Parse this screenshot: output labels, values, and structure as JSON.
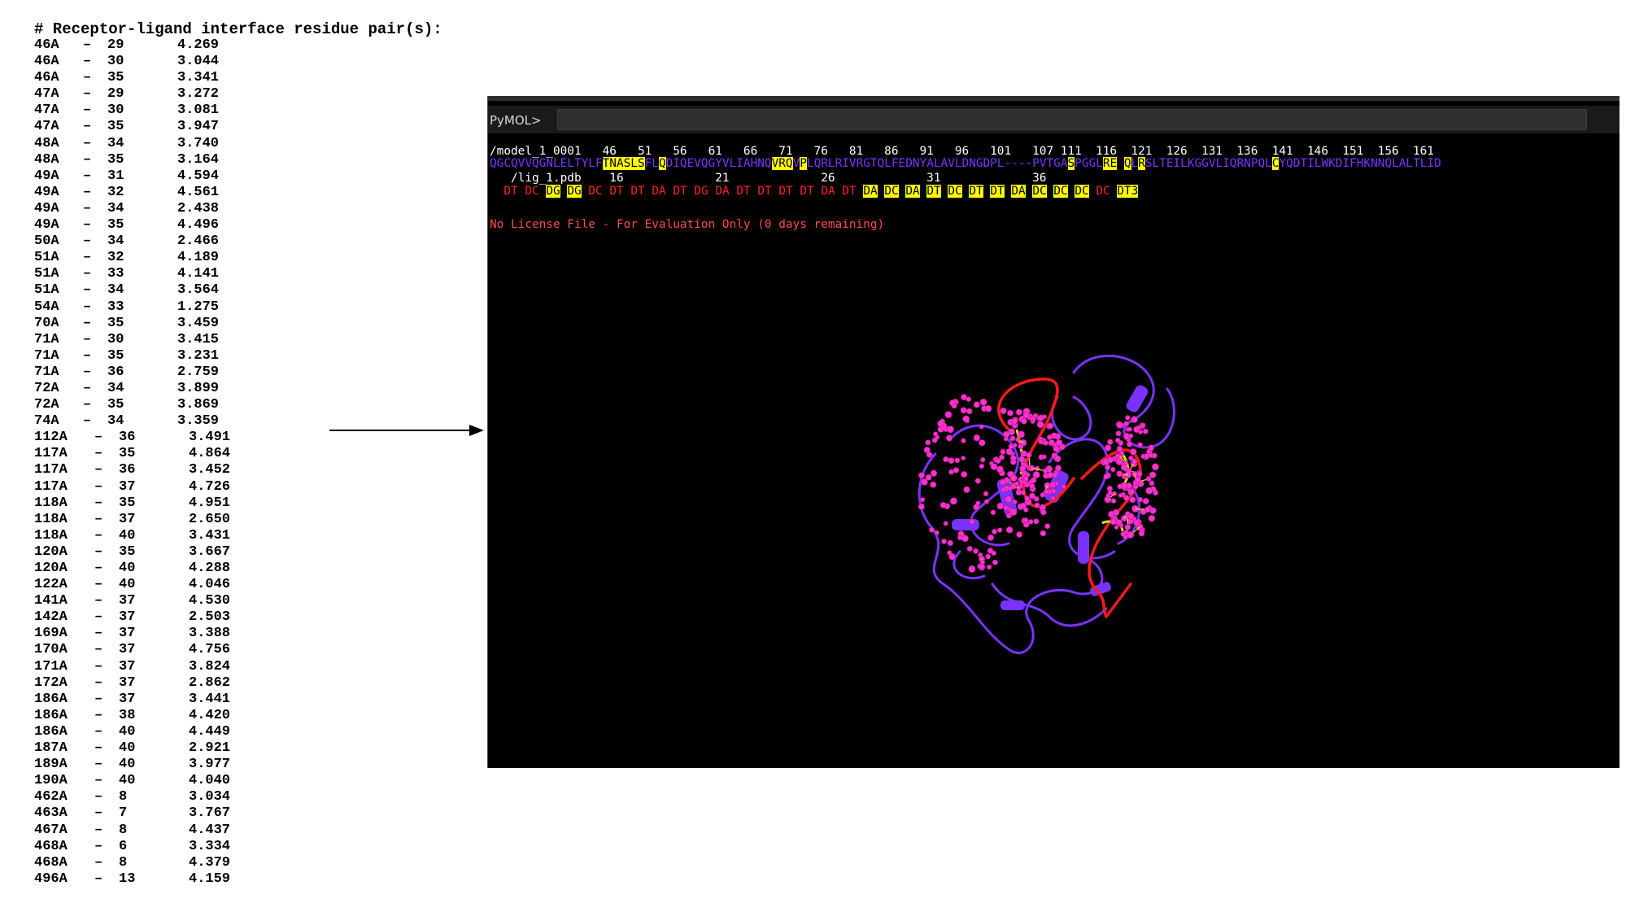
{
  "residue_list": {
    "header": "# Receptor-ligand interface residue pair(s):",
    "rows": [
      {
        "a": "46A",
        "b": "29",
        "d": "4.269"
      },
      {
        "a": "46A",
        "b": "30",
        "d": "3.044"
      },
      {
        "a": "46A",
        "b": "35",
        "d": "3.341"
      },
      {
        "a": "47A",
        "b": "29",
        "d": "3.272"
      },
      {
        "a": "47A",
        "b": "30",
        "d": "3.081"
      },
      {
        "a": "47A",
        "b": "35",
        "d": "3.947"
      },
      {
        "a": "48A",
        "b": "34",
        "d": "3.740"
      },
      {
        "a": "48A",
        "b": "35",
        "d": "3.164"
      },
      {
        "a": "49A",
        "b": "31",
        "d": "4.594"
      },
      {
        "a": "49A",
        "b": "32",
        "d": "4.561"
      },
      {
        "a": "49A",
        "b": "34",
        "d": "2.438"
      },
      {
        "a": "49A",
        "b": "35",
        "d": "4.496"
      },
      {
        "a": "50A",
        "b": "34",
        "d": "2.466"
      },
      {
        "a": "51A",
        "b": "32",
        "d": "4.189"
      },
      {
        "a": "51A",
        "b": "33",
        "d": "4.141"
      },
      {
        "a": "51A",
        "b": "34",
        "d": "3.564"
      },
      {
        "a": "54A",
        "b": "33",
        "d": "1.275"
      },
      {
        "a": "70A",
        "b": "35",
        "d": "3.459"
      },
      {
        "a": "71A",
        "b": "30",
        "d": "3.415"
      },
      {
        "a": "71A",
        "b": "35",
        "d": "3.231"
      },
      {
        "a": "71A",
        "b": "36",
        "d": "2.759"
      },
      {
        "a": "72A",
        "b": "34",
        "d": "3.899"
      },
      {
        "a": "72A",
        "b": "35",
        "d": "3.869"
      },
      {
        "a": "74A",
        "b": "34",
        "d": "3.359"
      },
      {
        "a": "112A",
        "b": "36",
        "d": "3.491"
      },
      {
        "a": "117A",
        "b": "35",
        "d": "4.864"
      },
      {
        "a": "117A",
        "b": "36",
        "d": "3.452"
      },
      {
        "a": "117A",
        "b": "37",
        "d": "4.726"
      },
      {
        "a": "118A",
        "b": "35",
        "d": "4.951"
      },
      {
        "a": "118A",
        "b": "37",
        "d": "2.650"
      },
      {
        "a": "118A",
        "b": "40",
        "d": "3.431"
      },
      {
        "a": "120A",
        "b": "35",
        "d": "3.667"
      },
      {
        "a": "120A",
        "b": "40",
        "d": "4.288"
      },
      {
        "a": "122A",
        "b": "40",
        "d": "4.046"
      },
      {
        "a": "141A",
        "b": "37",
        "d": "4.530"
      },
      {
        "a": "142A",
        "b": "37",
        "d": "2.503"
      },
      {
        "a": "169A",
        "b": "37",
        "d": "3.388"
      },
      {
        "a": "170A",
        "b": "37",
        "d": "4.756"
      },
      {
        "a": "171A",
        "b": "37",
        "d": "3.824"
      },
      {
        "a": "172A",
        "b": "37",
        "d": "2.862"
      },
      {
        "a": "186A",
        "b": "37",
        "d": "3.441"
      },
      {
        "a": "186A",
        "b": "38",
        "d": "4.420"
      },
      {
        "a": "186A",
        "b": "40",
        "d": "4.449"
      },
      {
        "a": "187A",
        "b": "40",
        "d": "2.921"
      },
      {
        "a": "189A",
        "b": "40",
        "d": "3.977"
      },
      {
        "a": "190A",
        "b": "40",
        "d": "4.040"
      },
      {
        "a": "462A",
        "b": "8",
        "d": "3.034"
      },
      {
        "a": "463A",
        "b": "7",
        "d": "3.767"
      },
      {
        "a": "467A",
        "b": "8",
        "d": "4.437"
      },
      {
        "a": "468A",
        "b": "6",
        "d": "3.334"
      },
      {
        "a": "468A",
        "b": "8",
        "d": "4.379"
      },
      {
        "a": "496A",
        "b": "13",
        "d": "4.159"
      }
    ]
  },
  "pymol": {
    "prompt": "PyMOL>",
    "command_value": "",
    "sequence": {
      "model_numbers": "/model_1_0001   46   51   56   61   66   71   76   81   86   91   96   101   107 111  116  121  126  131  136  141  146  151  156  161",
      "model_residues": [
        {
          "t": "QGCQVVQGNLELTYLF",
          "h": false
        },
        {
          "t": "TNASLS",
          "h": true
        },
        {
          "t": "FL",
          "h": false
        },
        {
          "t": "Q",
          "h": true
        },
        {
          "t": "DIQEVQGYVLIAHNQ",
          "h": false
        },
        {
          "t": "VRQ",
          "h": true
        },
        {
          "t": "V",
          "h": false
        },
        {
          "t": "P",
          "h": true
        },
        {
          "t": "LQRLRIVRGTQLFEDNYALAVLDNGDPL----PVTGA",
          "h": false
        },
        {
          "t": "S",
          "h": true
        },
        {
          "t": "PGGL",
          "h": false
        },
        {
          "t": "RE",
          "h": true
        },
        {
          "t": " ",
          "h": false
        },
        {
          "t": "Q",
          "h": true
        },
        {
          "t": "L",
          "h": false
        },
        {
          "t": "R",
          "h": true
        },
        {
          "t": "SLTEILKGGVLIQRNPQL",
          "h": false
        },
        {
          "t": "C",
          "h": true
        },
        {
          "t": "YQDTILWKDIFHKNNQLALTLID",
          "h": false
        }
      ],
      "ligand_numbers": "   /lig_1.pdb    16             21             26             31             36",
      "ligand_residues": [
        {
          "t": "DT",
          "h": false
        },
        {
          "t": "DC",
          "h": false
        },
        {
          "t": "DG",
          "h": true
        },
        {
          "t": "DG",
          "h": true
        },
        {
          "t": "DC",
          "h": false
        },
        {
          "t": "DT",
          "h": false
        },
        {
          "t": "DT",
          "h": false
        },
        {
          "t": "DA",
          "h": false
        },
        {
          "t": "DT",
          "h": false
        },
        {
          "t": "DG",
          "h": false
        },
        {
          "t": "DA",
          "h": false
        },
        {
          "t": "DT",
          "h": false
        },
        {
          "t": "DT",
          "h": false
        },
        {
          "t": "DT",
          "h": false
        },
        {
          "t": "DT",
          "h": false
        },
        {
          "t": "DA",
          "h": false
        },
        {
          "t": "DT",
          "h": false
        },
        {
          "t": "DA",
          "h": true
        },
        {
          "t": "DC",
          "h": true
        },
        {
          "t": "DA",
          "h": true
        },
        {
          "t": "DT",
          "h": true
        },
        {
          "t": "DC",
          "h": true
        },
        {
          "t": "DT",
          "h": true
        },
        {
          "t": "DT",
          "h": true
        },
        {
          "t": "DA",
          "h": true
        },
        {
          "t": "DC",
          "h": true
        },
        {
          "t": "DC",
          "h": true
        },
        {
          "t": "DC",
          "h": true
        },
        {
          "t": "DC",
          "h": false
        },
        {
          "t": "DT3",
          "h": true
        }
      ]
    },
    "license_message": "No License File - For Evaluation Only (0 days remaining)",
    "colors": {
      "background": "#000000",
      "protein": "#7a33ff",
      "dna": "#ff2020",
      "ligand_atoms": "#ff33cc",
      "highlight": "#ffff00"
    }
  }
}
